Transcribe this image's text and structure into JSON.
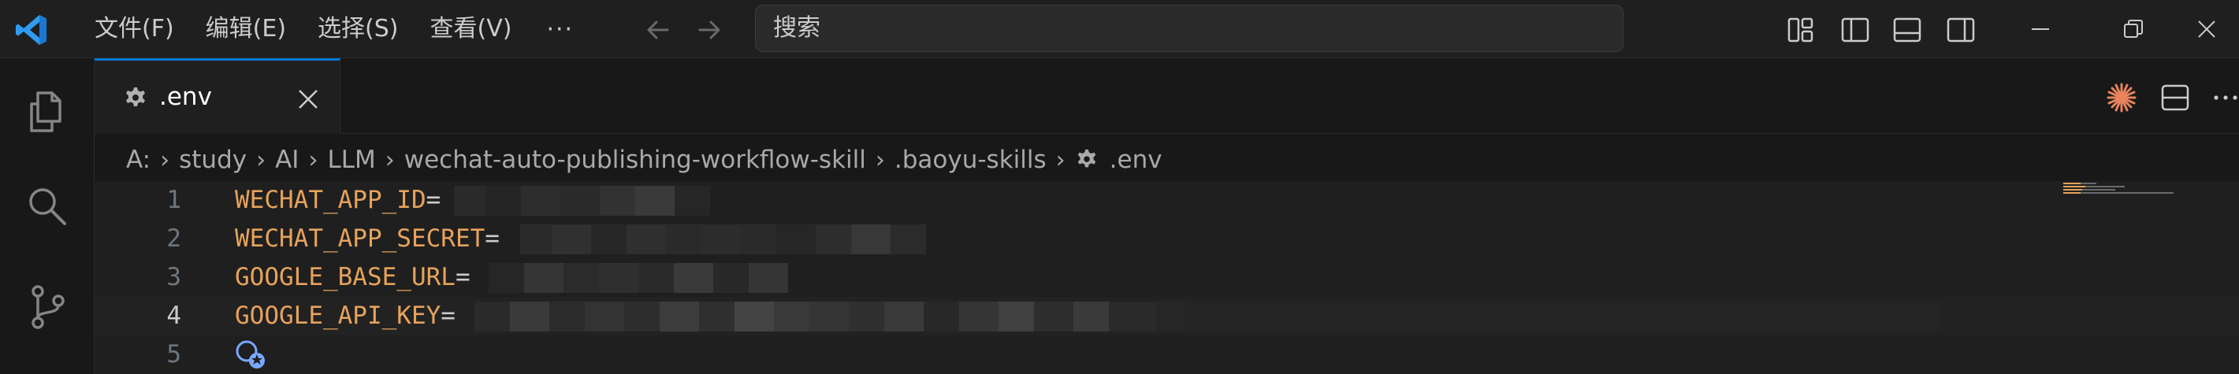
{
  "titlebar": {
    "menu": [
      "文件(F)",
      "编辑(E)",
      "选择(S)",
      "查看(V)"
    ],
    "more": "···",
    "search_placeholder": "搜索"
  },
  "tab": {
    "label": ".env"
  },
  "breadcrumb": [
    "A:",
    "study",
    "AI",
    "LLM",
    "wechat-auto-publishing-workflow-skill",
    ".baoyu-skills",
    ".env"
  ],
  "editor": {
    "lines": [
      {
        "num": "1",
        "key": "WECHAT_APP_ID",
        "eq": "="
      },
      {
        "num": "2",
        "key": "WECHAT_APP_SECRET",
        "eq": "="
      },
      {
        "num": "3",
        "key": "GOOGLE_BASE_URL",
        "eq": "="
      },
      {
        "num": "4",
        "key": "GOOGLE_API_KEY",
        "eq": "="
      },
      {
        "num": "5",
        "key": "",
        "eq": ""
      }
    ]
  },
  "colors": {
    "accent": "#0078d4",
    "key_text": "#e6a35c",
    "background": "#1f1f1f"
  }
}
